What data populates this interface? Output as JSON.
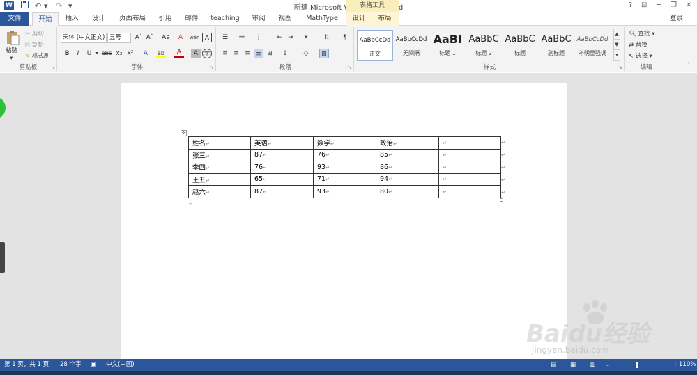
{
  "window": {
    "title": "新建 Microsoft Word 文档 - Word",
    "table_tools": "表格工具",
    "help": "?",
    "minimize": "─",
    "restore": "❐",
    "close": "✕"
  },
  "quick_access": {
    "save_icon": "save-icon",
    "undo": "↶",
    "redo": "↷",
    "more": "▾"
  },
  "tabs": [
    {
      "label": "文件"
    },
    {
      "label": "开始"
    },
    {
      "label": "插入"
    },
    {
      "label": "设计"
    },
    {
      "label": "页面布局"
    },
    {
      "label": "引用"
    },
    {
      "label": "邮件"
    },
    {
      "label": "teaching"
    },
    {
      "label": "审阅"
    },
    {
      "label": "视图"
    },
    {
      "label": "MathType"
    },
    {
      "label": "设计"
    },
    {
      "label": "布局"
    }
  ],
  "login": "登录",
  "ribbon": {
    "clipboard": {
      "paste": "粘贴",
      "cut": "剪切",
      "copy": "复制",
      "format_painter": "格式刷",
      "label": "剪贴板"
    },
    "font": {
      "font_name": "宋体 (中文正文)",
      "font_size": "五号",
      "label": "字体",
      "bold": "B",
      "italic": "I",
      "underline": "U",
      "strike": "abc",
      "sub": "x₂",
      "sup": "x²",
      "grow": "A˄",
      "shrink": "A˅",
      "case": "Aa",
      "clear": "A",
      "phonetic": "wén",
      "border_char": "A",
      "text_effect": "A",
      "highlight": "ab",
      "font_color": "A",
      "shade": "A",
      "circle": "字"
    },
    "paragraph": {
      "label": "段落"
    },
    "styles": {
      "label": "样式",
      "items": [
        {
          "preview": "AaBbCcDd",
          "name": "正文"
        },
        {
          "preview": "AaBbCcDd",
          "name": "无间隔"
        },
        {
          "preview": "AaBl",
          "name": "标题 1"
        },
        {
          "preview": "AaBbC",
          "name": "标题 2"
        },
        {
          "preview": "AaBbC",
          "name": "标题"
        },
        {
          "preview": "AaBbC",
          "name": "副标题"
        },
        {
          "preview": "AaBbCcDd",
          "name": "不明显强调"
        }
      ]
    },
    "editing": {
      "find": "查找",
      "replace": "替换",
      "select": "选择",
      "label": "编辑"
    }
  },
  "table": {
    "header": [
      "姓名",
      "英语",
      "数学",
      "政治",
      ""
    ],
    "rows": [
      [
        "张三",
        "87",
        "76",
        "85",
        ""
      ],
      [
        "李四",
        "76",
        "93",
        "86",
        ""
      ],
      [
        "王五",
        "65",
        "71",
        "94",
        ""
      ],
      [
        "赵六",
        "87",
        "93",
        "80",
        ""
      ]
    ]
  },
  "status": {
    "page": "第 1 页，共 1 页",
    "words": "28 个字",
    "language": "中文(中国)",
    "zoom": "110%",
    "zoom_minus": "-",
    "zoom_plus": "+"
  },
  "watermark": {
    "text": "Baidu经验",
    "url": "jingyan.baidu.com"
  },
  "colors": {
    "accent": "#2b579a",
    "context_tab": "#fbeebd",
    "status_bar": "#2b579a"
  }
}
